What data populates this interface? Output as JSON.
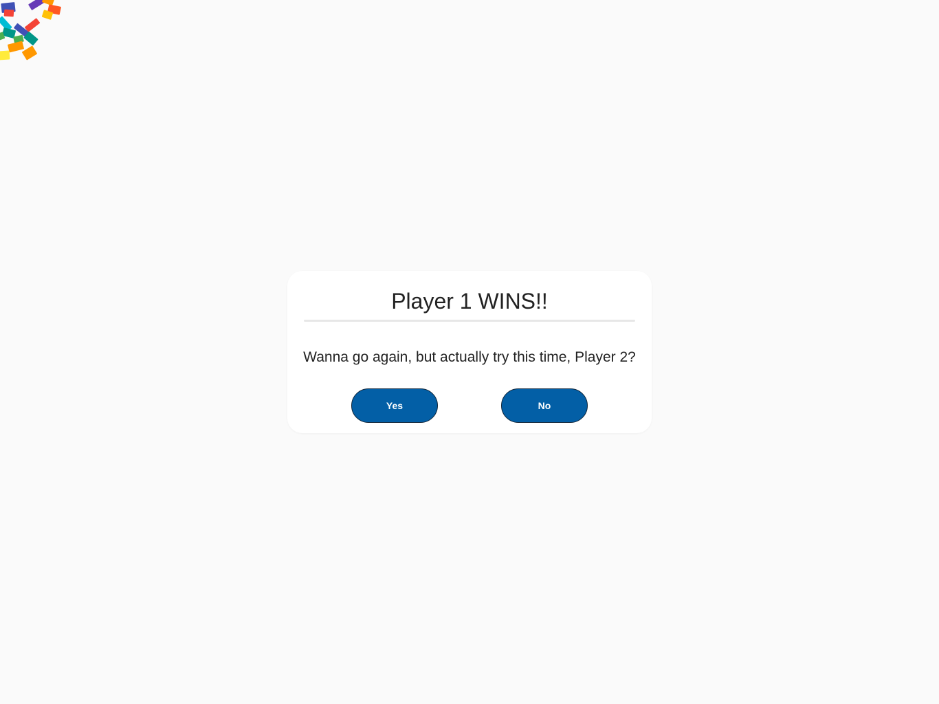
{
  "dialog": {
    "title": "Player 1 WINS!!",
    "message": "Wanna go again, but actually try this time, Player 2?",
    "yes_label": "Yes",
    "no_label": "No"
  },
  "colors": {
    "background": "#fafafa",
    "dialog_background": "#ffffff",
    "button": "#035fa6",
    "button_border": "#10253a",
    "text": "#222222"
  },
  "confetti": {
    "icon": "confetti",
    "colors": [
      "#f44336",
      "#3f51b5",
      "#673ab7",
      "#00bcd4",
      "#009688",
      "#ffeb3b",
      "#ff9800",
      "#ff5722"
    ]
  }
}
